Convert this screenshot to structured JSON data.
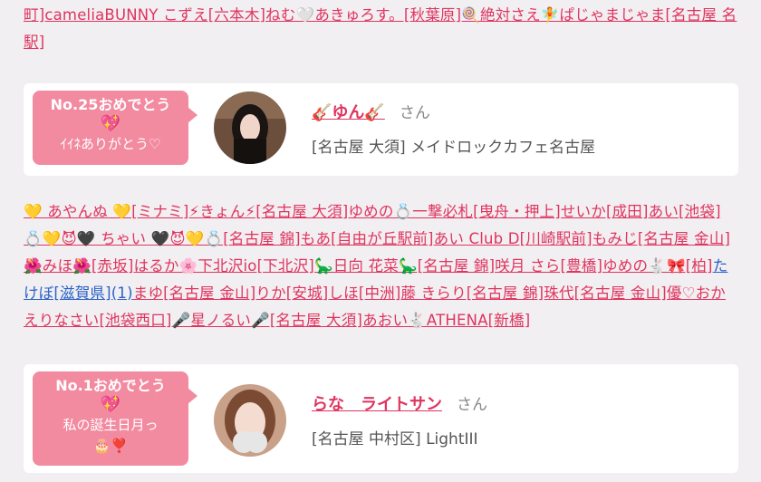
{
  "tags_top": [
    {
      "text": "町]cameliaBUNNY こずえ[六本木]ねむ🤍あきゅろす。[秋葉原]🍭絶対さえ🧚ぱじゃまじゃま[名古屋 名駅]"
    }
  ],
  "card1": {
    "bubble_line1": "No.25おめでとう",
    "bubble_heart": "💖",
    "bubble_line2": "ｲｲﾈありがとう♡",
    "name": "🎸ゆん🎸",
    "honorific": "さん",
    "shop": "[名古屋 大須] メイドロックカフェ名古屋"
  },
  "tags_mid": [
    {
      "text": "💛 あやんぬ 💛[ミナミ]⚡きょん⚡[名古屋 大須]ゆめの💍一撃必札[曳舟・押上]せいか[成田]あい[池袋]💍💛😈🖤 ちゃい 🖤😈💛💍[名古屋 錦]もあ[自由が丘駅前]あい Club D[川崎駅前]もみじ[名古屋 金山]🌺みほ🌺[赤坂]はるか🌸下北沢io[下北沢]🦕日向 花菜🦕[名古屋 錦]咲月 さら[豊橋]ゆめの🐇🎀[柏]",
      "blue": false
    },
    {
      "text": "たけぼ[滋賀県](1)",
      "blue": true
    },
    {
      "text": "まゆ[名古屋 金山]りか[安城]しほ[中洲]藤 きらり[名古屋 錦]珠代[名古屋 金山]優♡おかえりなさい[池袋西口]🎤星ノるい🎤[名古屋 大須]あおい🐇ATHENA[新橋]",
      "blue": false
    }
  ],
  "card2": {
    "bubble_line1": "No.1おめでとう",
    "bubble_heart": "💖",
    "bubble_line2": "私の誕生日月っ",
    "bubble_deco": "🎂❣️",
    "name": "らな　ライトサン",
    "honorific": "さん",
    "shop": "[名古屋 中村区] LightIII"
  }
}
